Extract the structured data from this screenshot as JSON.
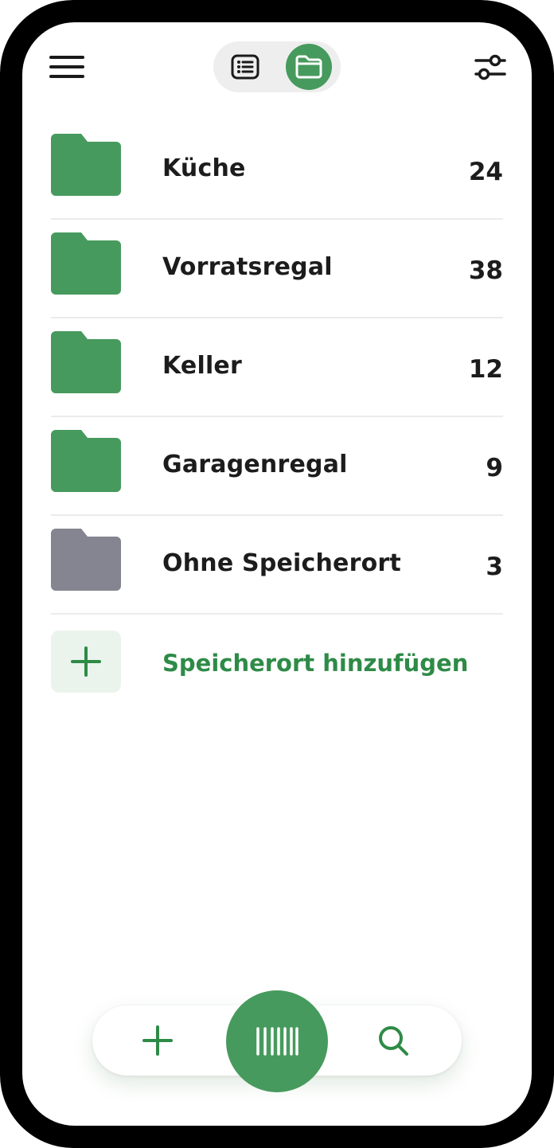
{
  "header": {
    "menu_icon": "hamburger-menu-icon",
    "view_toggle": {
      "options": [
        {
          "icon": "list-view-icon",
          "active": false
        },
        {
          "icon": "folder-view-icon",
          "active": true
        }
      ]
    },
    "filter_icon": "sliders-filter-icon"
  },
  "locations": [
    {
      "name": "Küche",
      "count": "24",
      "color": "#479a5d"
    },
    {
      "name": "Vorratsregal",
      "count": "38",
      "color": "#479a5d"
    },
    {
      "name": "Keller",
      "count": "12",
      "color": "#479a5d"
    },
    {
      "name": "Garagenregal",
      "count": "9",
      "color": "#479a5d"
    },
    {
      "name": "Ohne Speicherort",
      "count": "3",
      "color": "#858591"
    }
  ],
  "add_location": {
    "label": "Speicherort hinzufügen",
    "icon": "plus-icon"
  },
  "bottom_nav": {
    "add_icon": "plus-icon",
    "scan_icon": "barcode-icon",
    "search_icon": "search-icon"
  },
  "colors": {
    "accent": "#479a5d",
    "accent_text": "#2e8b47",
    "accent_tile": "#eaf4ec",
    "unassigned": "#858591",
    "text": "#1c1c1c"
  }
}
